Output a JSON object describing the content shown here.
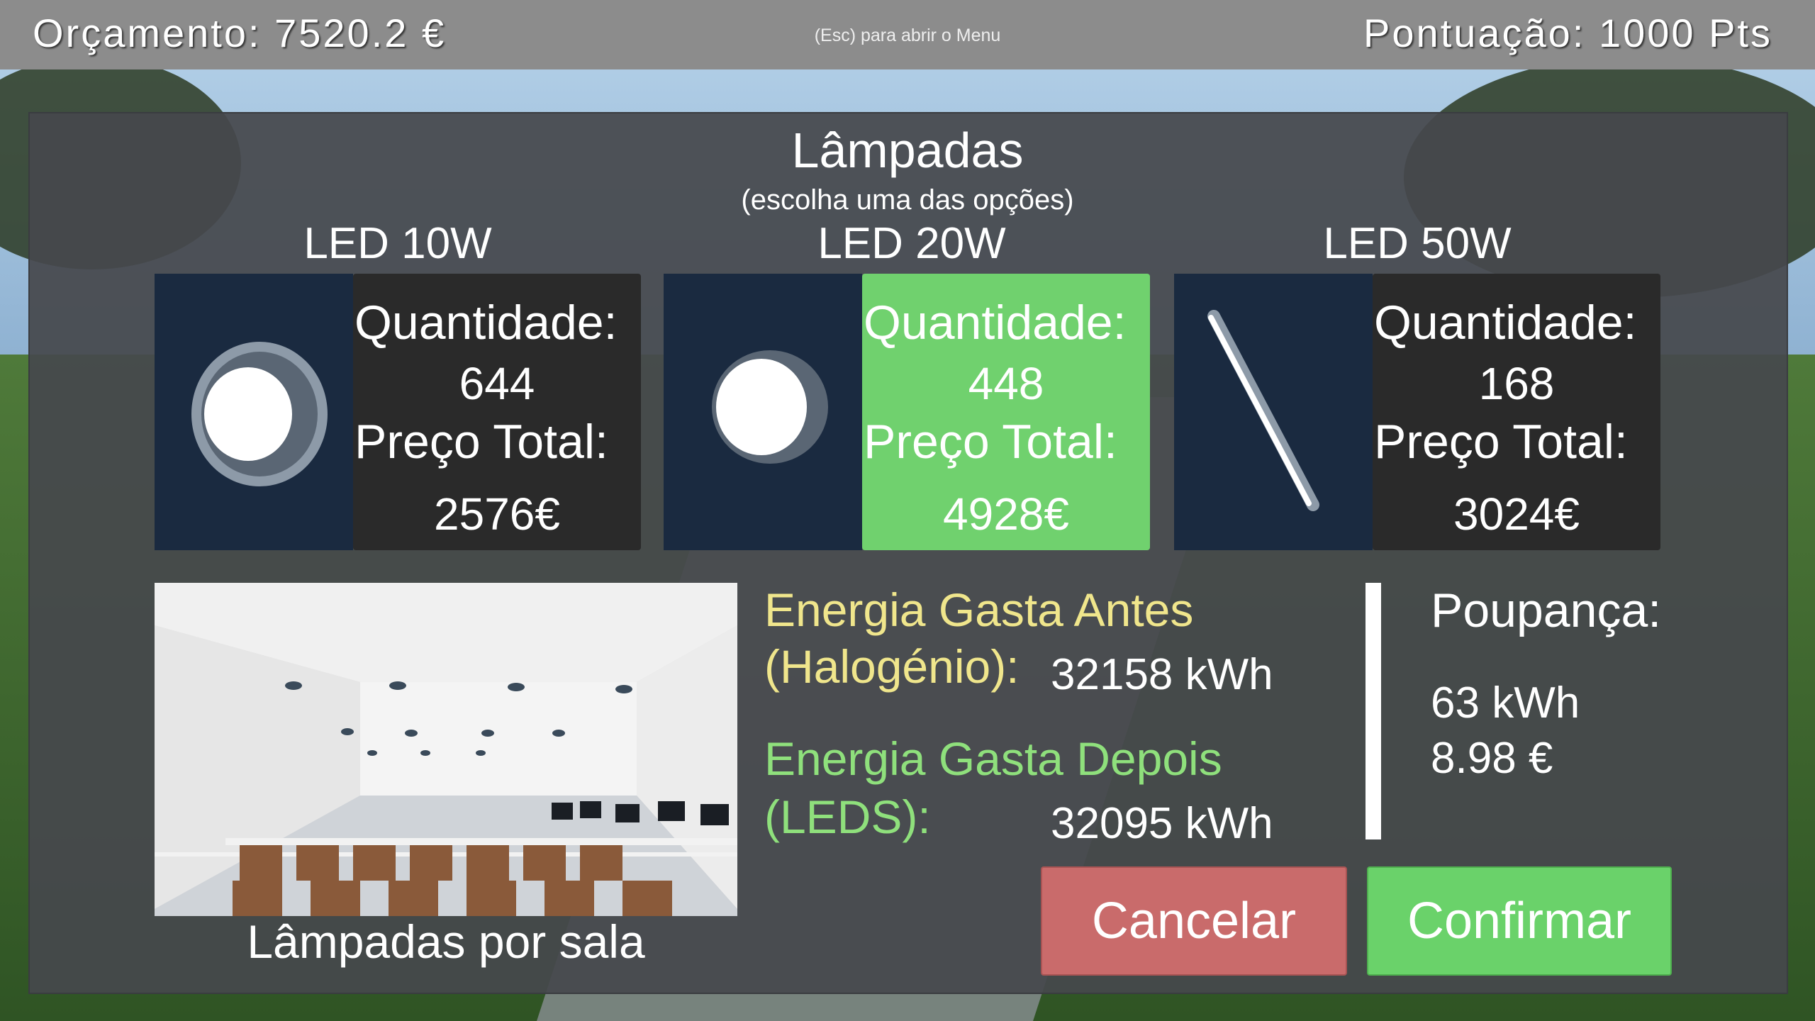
{
  "hud": {
    "budget": "Orçamento: 7520.2 €",
    "menu_hint": "(Esc) para abrir o Menu",
    "score": "Pontuação: 1000 Pts"
  },
  "dialog": {
    "title": "Lâmpadas",
    "subtitle": "(escolha uma das opções)",
    "options": [
      {
        "name": "LED 10W",
        "qty_label": "Quantidade:",
        "qty": "644",
        "price_label": "Preço Total:",
        "price": "2576€",
        "selected": false
      },
      {
        "name": "LED 20W",
        "qty_label": "Quantidade:",
        "qty": "448",
        "price_label": "Preço Total:",
        "price": "4928€",
        "selected": true
      },
      {
        "name": "LED 50W",
        "qty_label": "Quantidade:",
        "qty": "168",
        "price_label": "Preço Total:",
        "price": "3024€",
        "selected": false
      }
    ],
    "room_caption": "Lâmpadas por sala",
    "energy_before_label_1": "Energia Gasta Antes",
    "energy_before_label_2": "(Halogénio):",
    "energy_before_value": "32158 kWh",
    "energy_after_label_1": "Energia Gasta Depois",
    "energy_after_label_2": "(LEDS):",
    "energy_after_value": "32095 kWh",
    "savings_title": "Poupança:",
    "savings_kwh": "63 kWh",
    "savings_eur": "8.98 €",
    "cancel_label": "Cancelar",
    "confirm_label": "Confirmar"
  },
  "colors": {
    "selected_card": "#70d16e",
    "cancel_button": "#c96b6b",
    "confirm_button": "#6ad26a",
    "before_label": "#f0e68c",
    "after_label": "#8fe07c"
  }
}
